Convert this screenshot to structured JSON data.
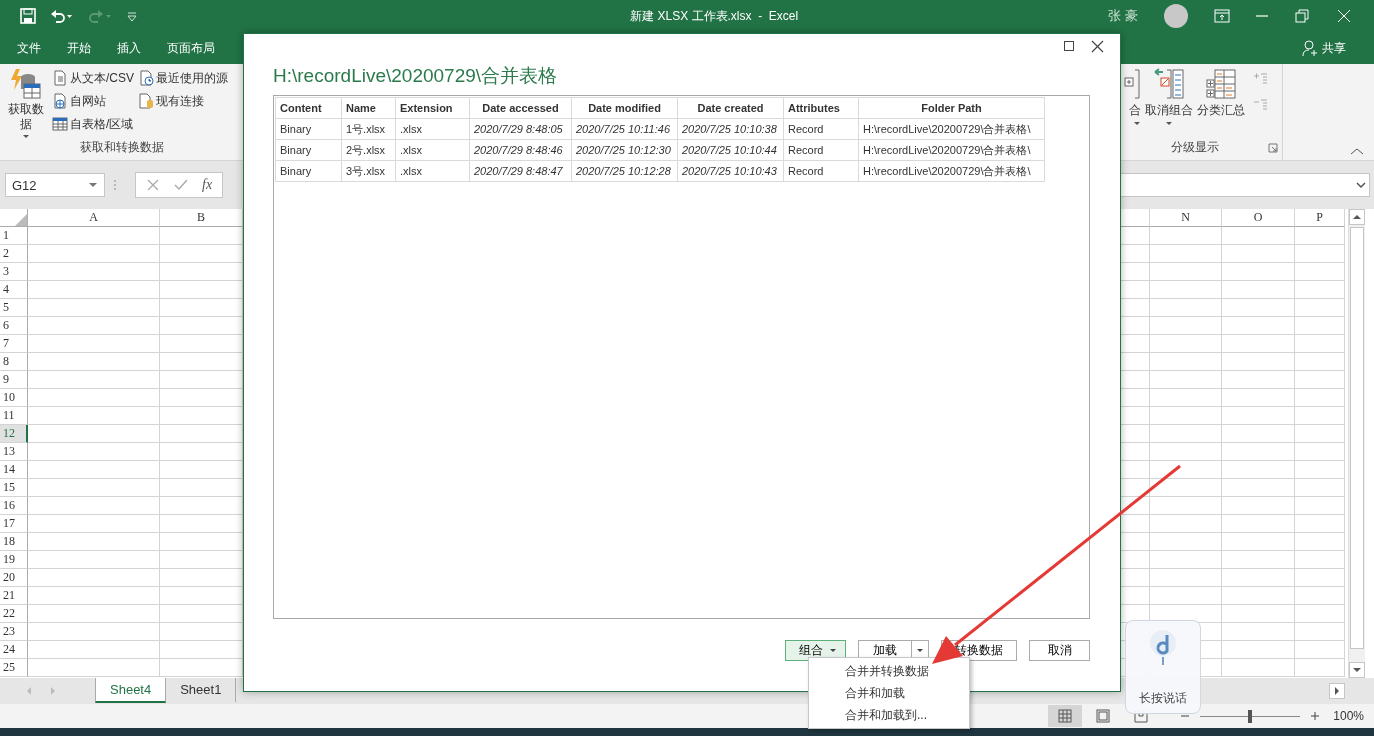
{
  "title_bar": {
    "title": "新建 XLSX 工作表.xlsx  -  Excel",
    "user": "张 豪"
  },
  "menu_tabs": [
    {
      "label": "文件",
      "selected": false
    },
    {
      "label": "开始",
      "selected": false
    },
    {
      "label": "插入",
      "selected": false
    },
    {
      "label": "页面布局",
      "selected": false
    }
  ],
  "share": "共享",
  "ribbon": {
    "get_data": {
      "big_button": "获取数据",
      "small_buttons": [
        {
          "label": "从文本/CSV",
          "kind": "text"
        },
        {
          "label": "自网站",
          "kind": "web"
        },
        {
          "label": "自表格/区域",
          "kind": "table"
        },
        {
          "label": "最近使用的源",
          "kind": "recent"
        },
        {
          "label": "现有连接",
          "kind": "connection"
        }
      ],
      "group_label": "获取和转换数据"
    },
    "outline": {
      "buttons": [
        {
          "label": "合",
          "kind": "group",
          "dropdown": true
        },
        {
          "label": "取消组合",
          "kind": "ungroup",
          "dropdown": true
        },
        {
          "label": "分类汇总",
          "kind": "subtotal",
          "dropdown": false
        }
      ],
      "group_label": "分级显示"
    }
  },
  "formula_bar": {
    "name_box": "G12",
    "function_button": "fx"
  },
  "sheet": {
    "columns": [
      {
        "label": "A"
      },
      {
        "label": "B"
      },
      {
        "label": "N"
      },
      {
        "label": "O"
      },
      {
        "label": "P"
      }
    ],
    "rows": [
      {
        "label": "1",
        "selected": false
      },
      {
        "label": "2",
        "selected": false
      },
      {
        "label": "3",
        "selected": false
      },
      {
        "label": "4",
        "selected": false
      },
      {
        "label": "5",
        "selected": false
      },
      {
        "label": "6",
        "selected": false
      },
      {
        "label": "7",
        "selected": false
      },
      {
        "label": "8",
        "selected": false
      },
      {
        "label": "9",
        "selected": false
      },
      {
        "label": "10",
        "selected": false
      },
      {
        "label": "11",
        "selected": false
      },
      {
        "label": "12",
        "selected": true
      },
      {
        "label": "13",
        "selected": false
      },
      {
        "label": "14",
        "selected": false
      },
      {
        "label": "15",
        "selected": false
      },
      {
        "label": "16",
        "selected": false
      },
      {
        "label": "17",
        "selected": false
      },
      {
        "label": "18",
        "selected": false
      },
      {
        "label": "19",
        "selected": false
      },
      {
        "label": "20",
        "selected": false
      },
      {
        "label": "21",
        "selected": false
      },
      {
        "label": "22",
        "selected": false
      },
      {
        "label": "23",
        "selected": false
      },
      {
        "label": "24",
        "selected": false
      },
      {
        "label": "25",
        "selected": false
      }
    ]
  },
  "sheet_tabs": [
    {
      "label": "Sheet4",
      "selected": true
    },
    {
      "label": "Sheet1",
      "selected": false
    }
  ],
  "status_bar": {
    "views": [
      {
        "kind": "normal",
        "selected": true
      },
      {
        "kind": "page-layout",
        "selected": false
      },
      {
        "kind": "page-break",
        "selected": false
      }
    ],
    "zoom": {
      "level": 0.5,
      "reading": "100%"
    }
  },
  "dialog": {
    "title": "H:\\recordLive\\20200729\\合并表格",
    "columns": [
      {
        "label": "Content",
        "italic": false
      },
      {
        "label": "Name",
        "italic": false
      },
      {
        "label": "Extension",
        "italic": false
      },
      {
        "label": "Date accessed",
        "italic": true
      },
      {
        "label": "Date modified",
        "italic": true
      },
      {
        "label": "Date created",
        "italic": true
      },
      {
        "label": "Attributes",
        "italic": false
      },
      {
        "label": "Folder Path",
        "italic": false
      }
    ],
    "rows": [
      [
        "Binary",
        "1号.xlsx",
        ".xlsx",
        "2020/7/29 8:48:05",
        "2020/7/25 10:11:46",
        "2020/7/25 10:10:38",
        "Record",
        "H:\\recordLive\\20200729\\合并表格\\"
      ],
      [
        "Binary",
        "2号.xlsx",
        ".xlsx",
        "2020/7/29 8:48:46",
        "2020/7/25 10:12:30",
        "2020/7/25 10:10:44",
        "Record",
        "H:\\recordLive\\20200729\\合并表格\\"
      ],
      [
        "Binary",
        "3号.xlsx",
        ".xlsx",
        "2020/7/29 8:48:47",
        "2020/7/25 10:12:28",
        "2020/7/25 10:10:43",
        "Record",
        "H:\\recordLive\\20200729\\合并表格\\"
      ]
    ],
    "buttons": [
      {
        "label": "组合",
        "kind": "dropdown",
        "selected": true
      },
      {
        "label": "加载",
        "kind": "split",
        "selected": false
      },
      {
        "label": "转换数据",
        "kind": "plain",
        "selected": false
      },
      {
        "label": "取消",
        "kind": "plain",
        "selected": false
      }
    ],
    "menu": [
      "合并并转换数据",
      "合并和加载",
      "合并和加载到..."
    ]
  },
  "voice_popup": {
    "label": "长按说话"
  }
}
